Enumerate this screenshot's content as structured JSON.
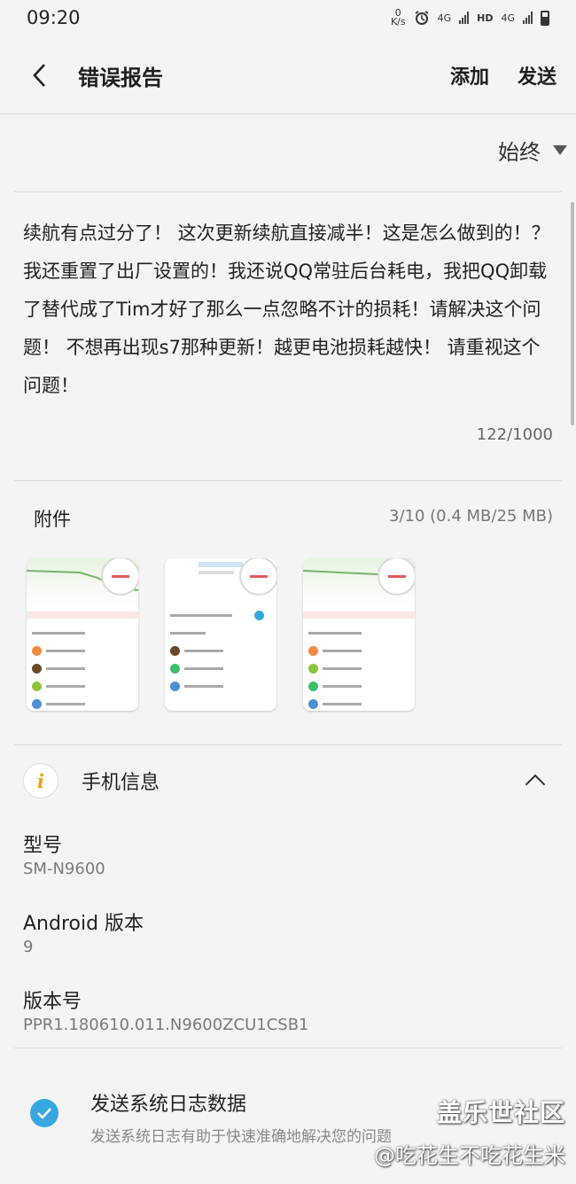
{
  "status_bar": {
    "time": "09:20",
    "net_speed_value": "0",
    "net_speed_unit": "K/s",
    "lte_1": "4G",
    "hd": "HD",
    "lte_2": "4G"
  },
  "app_bar": {
    "title": "错误报告",
    "add_label": "添加",
    "send_label": "发送"
  },
  "frequency": {
    "selected": "始终"
  },
  "report": {
    "body": "续航有点过分了！ 这次更新续航直接减半！这是怎么做到的！？我还重置了出厂设置的！我还说QQ常驻后台耗电，我把QQ卸载了替代成了Tim才好了那么一点忽略不计的损耗！请解决这个问题！ 不想再出现s7那种更新！越更电池损耗越快！ 请重视这个问题！",
    "char_count": "122/1000"
  },
  "attachments": {
    "label": "附件",
    "size_info": "3/10 (0.4 MB/25 MB)",
    "items": [
      {
        "name": "screenshot-1"
      },
      {
        "name": "screenshot-2"
      },
      {
        "name": "screenshot-3"
      }
    ]
  },
  "device_info": {
    "title": "手机信息",
    "model_label": "型号",
    "model_value": "SM-N9600",
    "android_label": "Android 版本",
    "android_value": "9",
    "build_label": "版本号",
    "build_value": "PPR1.180610.011.N9600ZCU1CSB1"
  },
  "logs": {
    "title": "发送系统日志数据",
    "subtitle": "发送系统日志有助于快速准确地解决您的问题",
    "checked": true
  },
  "watermark": {
    "line1": "盖乐世社区",
    "line2": "@吃花生不吃花生米"
  },
  "colors": {
    "accent": "#37a7e0",
    "remove": "#e35a5a",
    "info_icon": "#e8a21a"
  }
}
